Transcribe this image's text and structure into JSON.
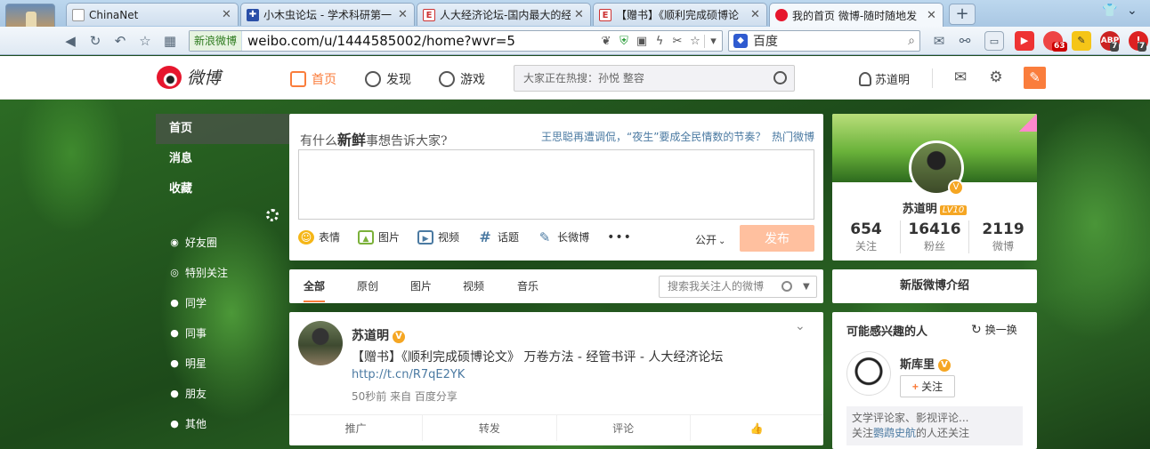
{
  "browser": {
    "tabs": [
      {
        "title": "ChinaNet",
        "icon": "page-icon"
      },
      {
        "title": "小木虫论坛 - 学术科研第一",
        "icon": "muchong-icon"
      },
      {
        "title": "人大经济论坛-国内最大的经",
        "icon": "pinggu-icon"
      },
      {
        "title": "【赠书】《顺利完成硕博论",
        "icon": "pinggu-icon"
      },
      {
        "title": "我的首页 微博-随时随地发",
        "icon": "weibo-icon"
      }
    ],
    "site_badge": "新浪微博",
    "url": "weibo.com/u/1444585002/home?wvr=5",
    "search_engine": "百度",
    "ext_badges": [
      "63",
      "7",
      "7"
    ]
  },
  "header": {
    "logo_text": "微博",
    "nav": [
      "首页",
      "发现",
      "游戏"
    ],
    "search_placeholder": "大家正在热搜：孙悦 整容",
    "user": "苏道明"
  },
  "left_nav": {
    "main": [
      "首页",
      "消息",
      "收藏"
    ],
    "groups": [
      "好友圈",
      "特别关注",
      "同学",
      "同事",
      "明星",
      "朋友",
      "其他"
    ]
  },
  "composer": {
    "prompt_a": "有什么",
    "prompt_b": "新鲜",
    "prompt_c": "事想告诉大家?",
    "hot_topic": "王思聪再遭调侃，“夜生”要成全民情数的节奏？",
    "hot_link": "热门微博",
    "tools": [
      "表情",
      "图片",
      "视频",
      "话题",
      "长微博"
    ],
    "visibility": "公开",
    "send": "发布"
  },
  "feed_tabs": {
    "tabs": [
      "全部",
      "原创",
      "图片",
      "视频",
      "音乐"
    ],
    "search_placeholder": "搜索我关注人的微博"
  },
  "post": {
    "author": "苏道明",
    "text": "【赠书】《顺利完成硕博论文》 万卷方法 - 经管书评 - 人大经济论坛",
    "link": "http://t.cn/R7qE2YK",
    "meta": "50秒前 来自 百度分享",
    "actions": [
      "推广",
      "转发",
      "评论"
    ]
  },
  "profile": {
    "name": "苏道明",
    "level": "LV10",
    "stats": [
      {
        "num": "654",
        "label": "关注"
      },
      {
        "num": "16416",
        "label": "粉丝"
      },
      {
        "num": "2119",
        "label": "微博"
      }
    ]
  },
  "new_version": "新版微博介绍",
  "interest": {
    "title": "可能感兴趣的人",
    "refresh": "换一换",
    "name": "斯库里",
    "follow": "关注",
    "desc_line1": "文学评论家、影视评论...",
    "desc_pre": "关注",
    "desc_link": "鹦鹉史航",
    "desc_post": "的人还关注"
  }
}
